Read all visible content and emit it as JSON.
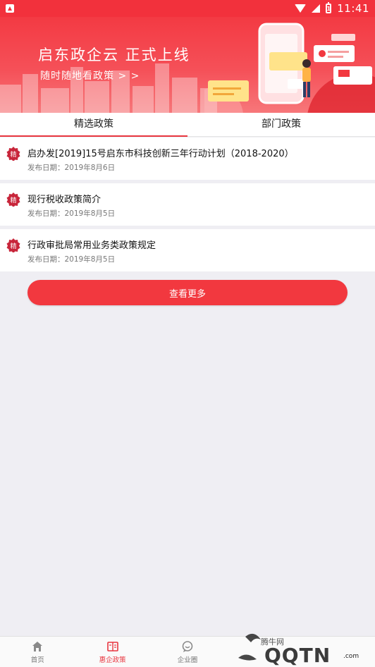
{
  "status_bar": {
    "time": "11:41",
    "battery_level": "1"
  },
  "banner": {
    "title": "启东政企云 正式上线",
    "subtitle": "随时随地看政策 > >"
  },
  "tabs": [
    {
      "label": "精选政策",
      "active": true
    },
    {
      "label": "部门政策",
      "active": false
    }
  ],
  "badge_text": "精",
  "policies": [
    {
      "title": "启办发[2019]15号启东市科技创新三年行动计划（2018-2020）",
      "date": "发布日期：2019年8月6日"
    },
    {
      "title": "现行税收政策简介",
      "date": "发布日期：2019年8月5日"
    },
    {
      "title": "行政审批局常用业务类政策规定",
      "date": "发布日期：2019年8月5日"
    }
  ],
  "more_button": "查看更多",
  "bottom_nav": [
    {
      "label": "首页",
      "icon": "home-icon",
      "active": false
    },
    {
      "label": "惠企政策",
      "icon": "policy-book-icon",
      "active": true
    },
    {
      "label": "企业圈",
      "icon": "chat-bubble-icon",
      "active": false
    },
    {
      "label": "",
      "icon": "",
      "active": false
    },
    {
      "label": "",
      "icon": "",
      "active": false
    }
  ],
  "watermark": {
    "brand": "腾牛网",
    "text": "QQTN",
    "domain": ".com"
  },
  "colors": {
    "accent": "#e8363f",
    "banner": "#f33a43",
    "background": "#efeef3"
  }
}
